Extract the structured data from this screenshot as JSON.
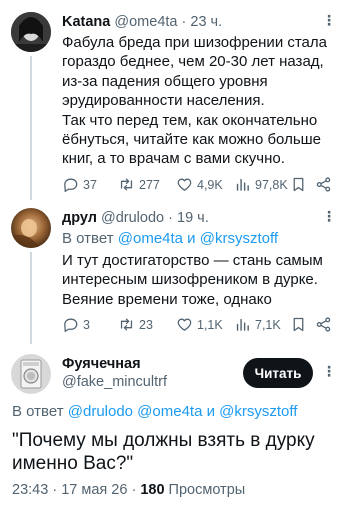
{
  "tweets": [
    {
      "name": "Katana",
      "handle": "@ome4ta",
      "separator": "·",
      "time": "23 ч.",
      "more_label": "⋮",
      "text": "Фабула бреда при шизофрении стала гораздо беднее, чем 20-30 лет назад, из-за падения общего уровня эрудированности населения.\nТак что перед тем, как окончательно ёбнуться, читайте как можно больше книг, а то врачам с вами скучно.",
      "replies": "37",
      "retweets": "277",
      "likes": "4,9K",
      "views": "97,8K"
    },
    {
      "name": "друл",
      "handle": "@drulodo",
      "separator": "·",
      "time": "19 ч.",
      "more_label": "⋮",
      "reply_prefix": "В ответ",
      "reply_mentions": "@ome4ta и @krsysztoff",
      "text": "И тут достигаторство — стань самым интересным шизофреником в дурке.\nВеяние времени тоже, однако",
      "replies": "3",
      "retweets": "23",
      "likes": "1,1K",
      "views": "7,1K"
    }
  ],
  "main_tweet": {
    "name": "Фуячечная",
    "handle": "@fake_mincultrf",
    "follow_label": "Читать",
    "more_label": "⋮",
    "reply_prefix": "В ответ",
    "reply_mentions": "@drulodo @ome4ta и @krsysztoff",
    "text": "\"Почему мы должны взять в дурку\nименно Вас?\"",
    "time": "23:43",
    "date": "17 мая 26",
    "dot": "·",
    "views_count": "180",
    "views_label": "Просмотры"
  },
  "colors": {
    "text": "#0f1419",
    "secondary": "#536471",
    "link": "#1d9bf0",
    "thread_line": "#cfd9de"
  },
  "icons": [
    "reply-icon",
    "retweet-icon",
    "like-icon",
    "views-icon",
    "bookmark-icon",
    "share-icon",
    "more-icon"
  ]
}
